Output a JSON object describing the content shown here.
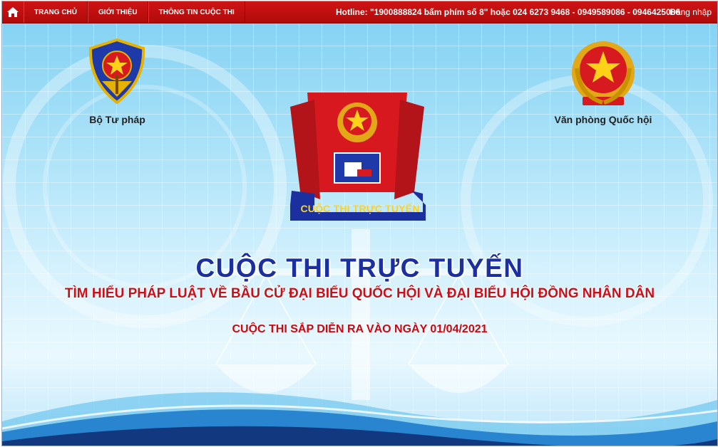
{
  "nav": {
    "home_icon": "home-icon",
    "items": [
      "TRANG CHỦ",
      "GIỚI THIỆU",
      "THÔNG TIN CUỘC THI"
    ],
    "hotline": "Hotline: \"1900888824 bấm phím số 8\" hoặc 024 6273 9468 - 0949589086 - 0946425086",
    "login": "Đăng nhập"
  },
  "logos": {
    "left_label": "Bộ Tư pháp",
    "right_label": "Văn phòng Quốc hội",
    "center_banner": "CUỘC THI TRỰC TUYẾN"
  },
  "headline": {
    "title": "CUỘC THI TRỰC TUYẾN",
    "subtitle": "TÌM HIỂU PHÁP LUẬT VỀ BẦU CỬ ĐẠI BIỂU QUỐC HỘI VÀ ĐẠI BIỂU HỘI ĐỒNG NHÂN DÂN",
    "date_notice": "CUỘC THI SẮP DIỄN RA VÀO NGÀY 01/04/2021"
  },
  "colors": {
    "nav_red": "#c40f0f",
    "title_blue": "#1b2f9e",
    "subtitle_red": "#c8101a",
    "gold": "#ffd21a"
  }
}
